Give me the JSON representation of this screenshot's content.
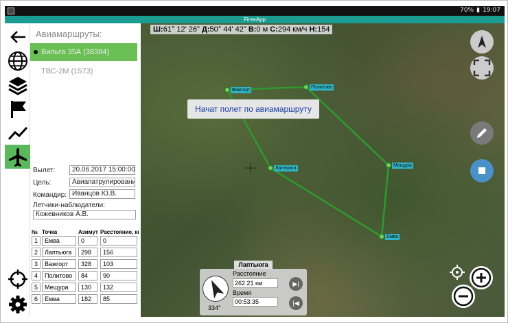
{
  "status_bar": {
    "battery": "70%",
    "time": "19:07"
  },
  "app": {
    "title": "FiresApp"
  },
  "sidebar_icons": [
    "back-arrow-icon",
    "globe-icon",
    "layers-icon",
    "flag-icon",
    "chart-icon",
    "airplane-icon",
    "crosshair-icon",
    "settings-icon"
  ],
  "routes": {
    "header": "Авиамаршруты:",
    "items": [
      {
        "label": "Вильга 35А (38384)",
        "selected": true
      },
      {
        "label": "ТВС-2М (1573)",
        "selected": false
      }
    ]
  },
  "flight": {
    "departure_label": "Вылет:",
    "departure_value": "20.06.2017 15:00:00",
    "purpose_label": "Цель:",
    "purpose_value": "Авиапатрулирование",
    "commander_label": "Командир:",
    "commander_value": "Иванцов Ю.В.",
    "observers_label": "Летчики-наблюдатели:",
    "observers_value": "Кожевников А.В."
  },
  "points_table": {
    "headers": [
      "№",
      "Точка",
      "Азимут",
      "Расстояние, км"
    ],
    "rows": [
      [
        "1",
        "Емва",
        "0",
        "0"
      ],
      [
        "2",
        "Лаптьюга",
        "298",
        "156"
      ],
      [
        "3",
        "Важгорт",
        "328",
        "103"
      ],
      [
        "4",
        "Политово",
        "84",
        "90"
      ],
      [
        "5",
        "Мещура",
        "130",
        "132"
      ],
      [
        "6",
        "Емва",
        "182",
        "85"
      ]
    ]
  },
  "map": {
    "coords": {
      "lat_label": "Ш:",
      "lat": "61° 12' 26\"",
      "lon_label": "Д:",
      "lon": "50° 44' 42\"",
      "alt_label": "В:",
      "alt": "0 м",
      "speed_label": "С:",
      "speed": "294 км/ч",
      "height_label": "Н:",
      "height": "154"
    },
    "toast": "Начат полет по авиамаршруту",
    "waypoints": [
      "Важгорт",
      "Политово",
      "Мещура",
      "Лаптьюга",
      "Емва"
    ],
    "route_color": "#2e9a2e"
  },
  "nav_panel": {
    "title": "Лаптьюга",
    "distance_label": "Расстояние",
    "distance_value": "262.21 км",
    "time_label": "Время",
    "time_value": "00:53:35",
    "heading": "334°"
  }
}
